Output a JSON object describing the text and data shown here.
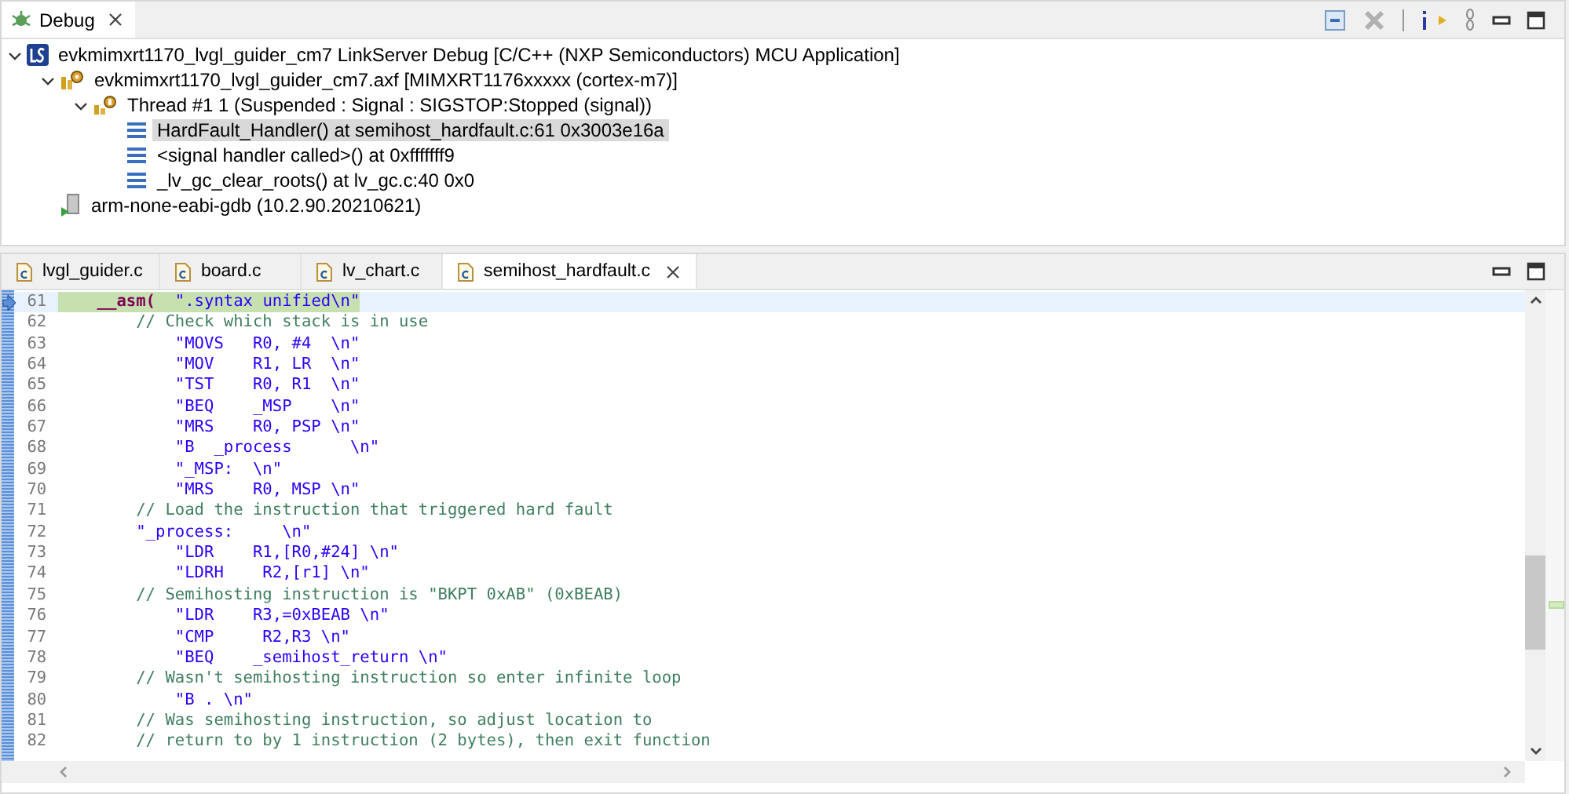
{
  "debug_view": {
    "tab": {
      "title": "Debug"
    },
    "tree": [
      {
        "kind": "launch",
        "label": "evkmimxrt1170_lvgl_guider_cm7 LinkServer Debug [C/C++ (NXP Semiconductors) MCU Application]",
        "expanded": true,
        "children": [
          {
            "kind": "process",
            "label": "evkmimxrt1170_lvgl_guider_cm7.axf [MIMXRT1176xxxxx (cortex-m7)]",
            "expanded": true,
            "children": [
              {
                "kind": "thread",
                "label": "Thread #1 1 (Suspended : Signal : SIGSTOP:Stopped (signal))",
                "expanded": true,
                "children": [
                  {
                    "kind": "frame",
                    "label": "HardFault_Handler() at semihost_hardfault.c:61 0x3003e16a",
                    "selected": true
                  },
                  {
                    "kind": "frame",
                    "label": "<signal handler called>() at 0xfffffff9",
                    "selected": false
                  },
                  {
                    "kind": "frame",
                    "label": "_lv_gc_clear_roots() at lv_gc.c:40 0x0",
                    "selected": false
                  }
                ]
              }
            ]
          },
          {
            "kind": "debugger",
            "label": "arm-none-eabi-gdb (10.2.90.20210621)"
          }
        ]
      }
    ]
  },
  "editor": {
    "tabs": [
      {
        "label": "lvgl_guider.c",
        "selected": false
      },
      {
        "label": "board.c",
        "selected": false
      },
      {
        "label": "lv_chart.c",
        "selected": false
      },
      {
        "label": "semihost_hardfault.c",
        "selected": true
      }
    ],
    "lines": [
      {
        "number": "61",
        "current": true,
        "tokens": [
          {
            "kind": "keyword",
            "text": "    __asm("
          },
          {
            "kind": "string",
            "text": "  \".syntax unified\\n\""
          }
        ]
      },
      {
        "number": "62",
        "current": false,
        "tokens": [
          {
            "kind": "comment",
            "text": "        // Check which stack is in use"
          }
        ]
      },
      {
        "number": "63",
        "current": false,
        "tokens": [
          {
            "kind": "string",
            "text": "            \"MOVS   R0, #4  \\n\""
          }
        ]
      },
      {
        "number": "64",
        "current": false,
        "tokens": [
          {
            "kind": "string",
            "text": "            \"MOV    R1, LR  \\n\""
          }
        ]
      },
      {
        "number": "65",
        "current": false,
        "tokens": [
          {
            "kind": "string",
            "text": "            \"TST    R0, R1  \\n\""
          }
        ]
      },
      {
        "number": "66",
        "current": false,
        "tokens": [
          {
            "kind": "string",
            "text": "            \"BEQ    _MSP    \\n\""
          }
        ]
      },
      {
        "number": "67",
        "current": false,
        "tokens": [
          {
            "kind": "string",
            "text": "            \"MRS    R0, PSP \\n\""
          }
        ]
      },
      {
        "number": "68",
        "current": false,
        "tokens": [
          {
            "kind": "string",
            "text": "            \"B  _process      \\n\""
          }
        ]
      },
      {
        "number": "69",
        "current": false,
        "tokens": [
          {
            "kind": "string",
            "text": "            \"_MSP:  \\n\""
          }
        ]
      },
      {
        "number": "70",
        "current": false,
        "tokens": [
          {
            "kind": "string",
            "text": "            \"MRS    R0, MSP \\n\""
          }
        ]
      },
      {
        "number": "71",
        "current": false,
        "tokens": [
          {
            "kind": "comment",
            "text": "        // Load the instruction that triggered hard fault"
          }
        ]
      },
      {
        "number": "72",
        "current": false,
        "tokens": [
          {
            "kind": "string",
            "text": "        \"_process:     \\n\""
          }
        ]
      },
      {
        "number": "73",
        "current": false,
        "tokens": [
          {
            "kind": "string",
            "text": "            \"LDR    R1,[R0,#24] \\n\""
          }
        ]
      },
      {
        "number": "74",
        "current": false,
        "tokens": [
          {
            "kind": "string",
            "text": "            \"LDRH    R2,[r1] \\n\""
          }
        ]
      },
      {
        "number": "75",
        "current": false,
        "tokens": [
          {
            "kind": "comment",
            "text": "        // Semihosting instruction is \"BKPT 0xAB\" (0xBEAB)"
          }
        ]
      },
      {
        "number": "76",
        "current": false,
        "tokens": [
          {
            "kind": "string",
            "text": "            \"LDR    R3,=0xBEAB \\n\""
          }
        ]
      },
      {
        "number": "77",
        "current": false,
        "tokens": [
          {
            "kind": "string",
            "text": "            \"CMP     R2,R3 \\n\""
          }
        ]
      },
      {
        "number": "78",
        "current": false,
        "tokens": [
          {
            "kind": "string",
            "text": "            \"BEQ    _semihost_return \\n\""
          }
        ]
      },
      {
        "number": "79",
        "current": false,
        "tokens": [
          {
            "kind": "comment",
            "text": "        // Wasn't semihosting instruction so enter infinite loop"
          }
        ]
      },
      {
        "number": "80",
        "current": false,
        "tokens": [
          {
            "kind": "string",
            "text": "            \"B . \\n\""
          }
        ]
      },
      {
        "number": "81",
        "current": false,
        "tokens": [
          {
            "kind": "comment",
            "text": "        // Was semihosting instruction, so adjust location to"
          }
        ]
      },
      {
        "number": "82",
        "current": false,
        "tokens": [
          {
            "kind": "comment",
            "text": "        // return to by 1 instruction (2 bytes), then exit function"
          }
        ]
      }
    ]
  }
}
